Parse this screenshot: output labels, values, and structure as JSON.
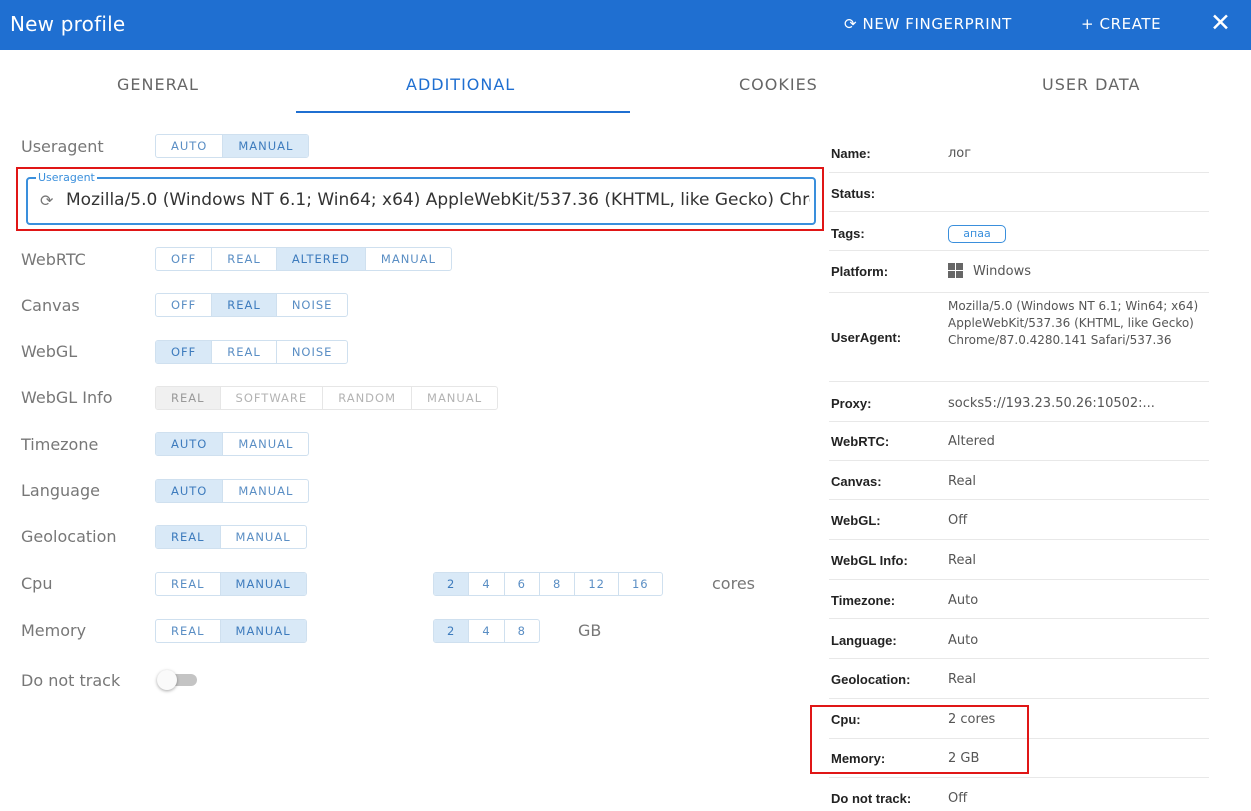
{
  "header": {
    "title": "New profile",
    "new_fingerprint": "NEW FINGERPRINT",
    "create": "CREATE",
    "close_glyph": "✕"
  },
  "tabs": [
    "GENERAL",
    "ADDITIONAL",
    "COOKIES",
    "USER DATA"
  ],
  "active_tab": "ADDITIONAL",
  "settings": {
    "useragent": {
      "label": "Useragent",
      "options": [
        "AUTO",
        "MANUAL"
      ],
      "selected": "MANUAL",
      "field_label": "Useragent",
      "value": "Mozilla/5.0 (Windows NT 6.1; Win64; x64) AppleWebKit/537.36 (KHTML, like Gecko) Chrome/87.0.4280.141 Safari/537.36"
    },
    "webrtc": {
      "label": "WebRTC",
      "options": [
        "OFF",
        "REAL",
        "ALTERED",
        "MANUAL"
      ],
      "selected": "ALTERED"
    },
    "canvas": {
      "label": "Canvas",
      "options": [
        "OFF",
        "REAL",
        "NOISE"
      ],
      "selected": "REAL"
    },
    "webgl": {
      "label": "WebGL",
      "options": [
        "OFF",
        "REAL",
        "NOISE"
      ],
      "selected": "OFF"
    },
    "webgl_info": {
      "label": "WebGL Info",
      "options": [
        "REAL",
        "SOFTWARE",
        "RANDOM",
        "MANUAL"
      ],
      "selected": "REAL",
      "disabled": true
    },
    "timezone": {
      "label": "Timezone",
      "options": [
        "AUTO",
        "MANUAL"
      ],
      "selected": "AUTO"
    },
    "language": {
      "label": "Language",
      "options": [
        "AUTO",
        "MANUAL"
      ],
      "selected": "AUTO"
    },
    "geolocation": {
      "label": "Geolocation",
      "options": [
        "REAL",
        "MANUAL"
      ],
      "selected": "REAL"
    },
    "cpu": {
      "label": "Cpu",
      "options": [
        "REAL",
        "MANUAL"
      ],
      "selected": "MANUAL",
      "cores": [
        "2",
        "4",
        "6",
        "8",
        "12",
        "16"
      ],
      "cores_selected": "2",
      "unit": "cores"
    },
    "memory": {
      "label": "Memory",
      "options": [
        "REAL",
        "MANUAL"
      ],
      "selected": "MANUAL",
      "sizes": [
        "2",
        "4",
        "8"
      ],
      "size_selected": "2",
      "unit": "GB"
    },
    "dnt": {
      "label": "Do not track",
      "enabled": false
    }
  },
  "summary": [
    {
      "key": "Name:",
      "value": "лог"
    },
    {
      "key": "Status:",
      "value": ""
    },
    {
      "key": "Tags:",
      "value": "апаа"
    },
    {
      "key": "Platform:",
      "value": "Windows"
    },
    {
      "key": "UserAgent:",
      "value": "Mozilla/5.0 (Windows NT 6.1; Win64; x64) AppleWebKit/537.36 (KHTML, like Gecko) Chrome/87.0.4280.141 Safari/537.36"
    },
    {
      "key": "Proxy:",
      "value": "socks5://193.23.50.26:10502:..."
    },
    {
      "key": "WebRTC:",
      "value": "Altered"
    },
    {
      "key": "Canvas:",
      "value": "Real"
    },
    {
      "key": "WebGL:",
      "value": "Off"
    },
    {
      "key": "WebGL Info:",
      "value": "Real"
    },
    {
      "key": "Timezone:",
      "value": "Auto"
    },
    {
      "key": "Language:",
      "value": "Auto"
    },
    {
      "key": "Geolocation:",
      "value": "Real"
    },
    {
      "key": "Cpu:",
      "value": "2 cores"
    },
    {
      "key": "Memory:",
      "value": "2 GB"
    },
    {
      "key": "Do not track:",
      "value": "Off"
    }
  ],
  "colors": {
    "header": "#1f6fd1",
    "accent": "#3a8fdc",
    "highlight": "#e01616"
  }
}
